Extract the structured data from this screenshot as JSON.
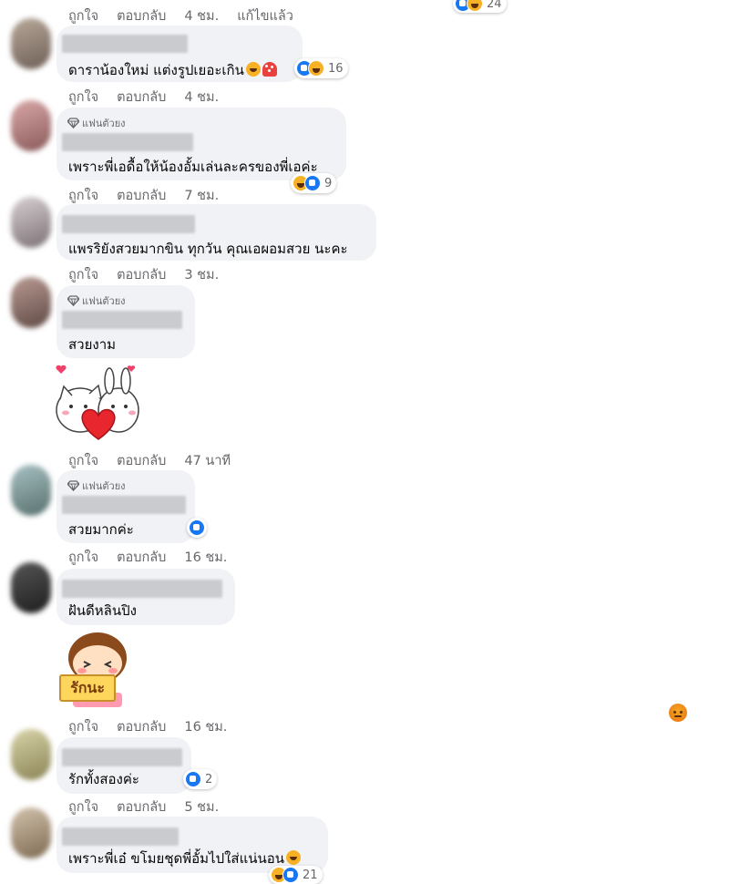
{
  "actions": {
    "like": "ถูกใจ",
    "reply": "ตอบกลับ",
    "edited": "แก้ไขแล้ว"
  },
  "top": {
    "time": "4 ชม.",
    "reaction_count": "24"
  },
  "badge_label": "แฟนตัวยง",
  "comments": [
    {
      "text": "ดาราน้องใหม่ แต่งรูปเยอะเกิน",
      "reaction_count": "16",
      "time": "4 ชม."
    },
    {
      "text": "เพราะพี่เอดื้อให้น้องอั้มเล่นละครของพี่เอค่ะ",
      "reaction_count": "9",
      "time": "7 ชม."
    },
    {
      "text": "แพรริยังสวยมากขิน ทุกวัน คุณเอผอมสวย นะคะ",
      "time": "3 ชม."
    },
    {
      "text": "สวยงาม",
      "time": "47 นาที"
    },
    {
      "text": "สวยมากค่ะ",
      "time": "16 ชม."
    },
    {
      "text": "ฝันดีหลินปิง",
      "time": "16 ชม."
    },
    {
      "text": "รักทั้งสองค่ะ",
      "reaction_count": "2",
      "time": "5 ชม."
    },
    {
      "text": "เพราะพี่เอ๋ ขโมยชุดพี่อั้มไปใส่แน่นอน",
      "reaction_count": "21"
    }
  ],
  "sticker2_text": "รักนะ",
  "colors": {
    "like_blue": "#1877f2",
    "bubble": "#f0f2f5",
    "meta_gray": "#65676b",
    "angry_orange": "#e9710f"
  },
  "icons": [
    "like-icon",
    "haha-icon",
    "diamond-icon",
    "angry-icon",
    "rofl-emoji",
    "mushroom-emoji"
  ]
}
